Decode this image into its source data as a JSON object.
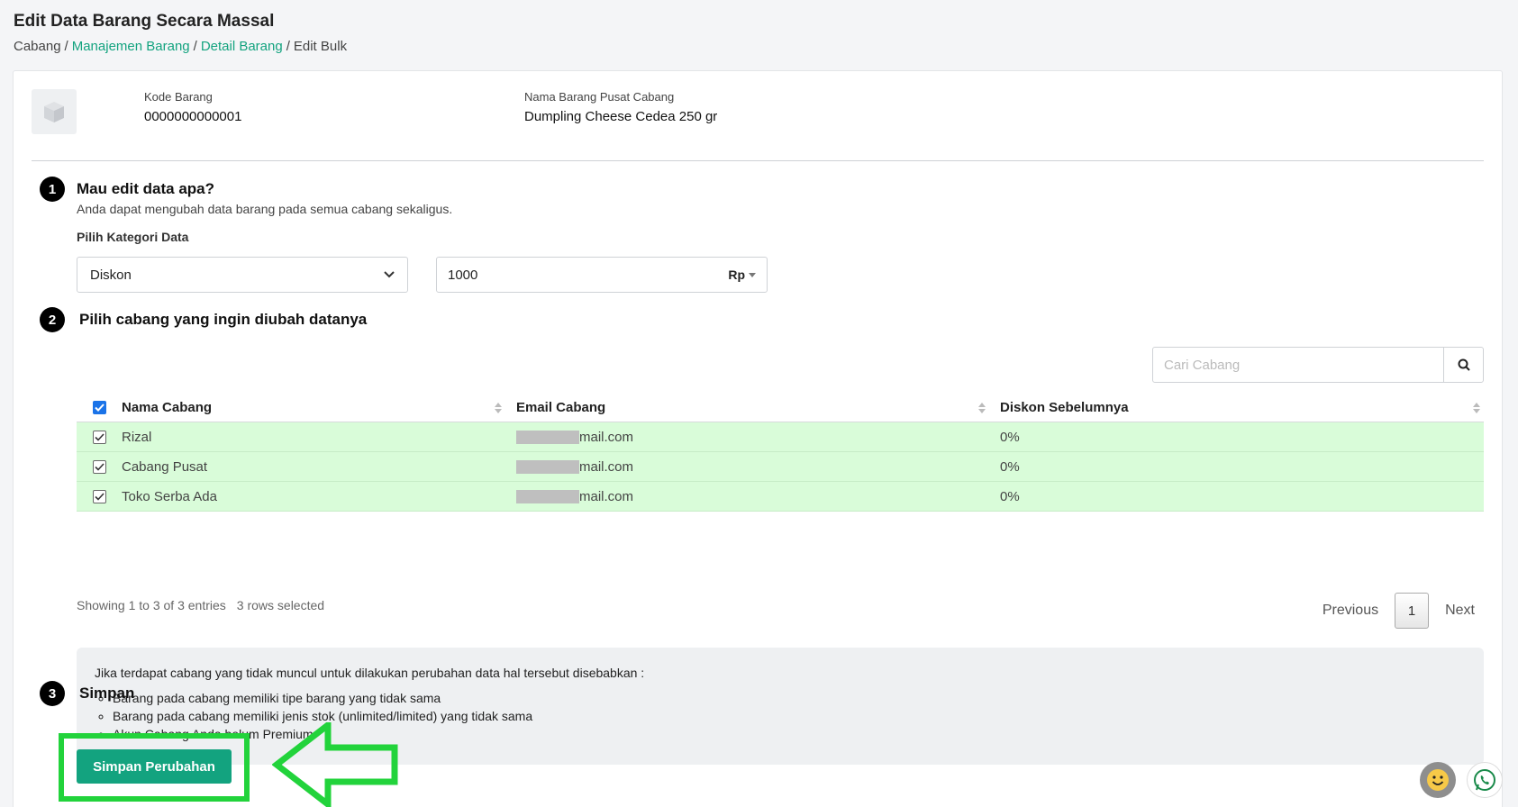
{
  "page": {
    "title": "Edit Data Barang Secara Massal",
    "breadcrumb": [
      "Cabang",
      "Manajemen Barang",
      "Detail Barang",
      "Edit Bulk"
    ]
  },
  "product": {
    "code_label": "Kode Barang",
    "code_value": "0000000000001",
    "name_label": "Nama Barang Pusat Cabang",
    "name_value": "Dumpling Cheese Cedea 250 gr"
  },
  "step1": {
    "number": "1",
    "title": "Mau edit data apa?",
    "subtitle": "Anda dapat mengubah data barang pada semua cabang sekaligus.",
    "category_label": "Pilih Kategori Data",
    "category_value": "Diskon",
    "amount_value": "1000",
    "amount_unit": "Rp"
  },
  "step2": {
    "number": "2",
    "title": "Pilih cabang yang ingin diubah datanya",
    "search_placeholder": "Cari Cabang",
    "table": {
      "columns": [
        "Nama Cabang",
        "Email Cabang",
        "Diskon Sebelumnya"
      ],
      "rows": [
        {
          "name": "Rizal",
          "email_suffix": "mail.com",
          "discount": "0%"
        },
        {
          "name": "Cabang Pusat",
          "email_suffix": "mail.com",
          "discount": "0%"
        },
        {
          "name": "Toko Serba Ada",
          "email_suffix": "mail.com",
          "discount": "0%"
        }
      ]
    },
    "entries_info": "Showing 1 to 3 of 3 entries",
    "selected_info": "3 rows selected",
    "pagination": {
      "previous": "Previous",
      "current": "1",
      "next": "Next"
    }
  },
  "note": {
    "intro": "Jika terdapat cabang yang tidak muncul untuk dilakukan perubahan data hal tersebut disebabkan :",
    "items": [
      "Barang pada cabang memiliki tipe barang yang tidak sama",
      "Barang pada cabang memiliki jenis stok (unlimited/limited) yang tidak sama",
      "Akun Cabang Anda belum Premium"
    ]
  },
  "step3": {
    "number": "3",
    "title": "Simpan",
    "save_label": "Simpan Perubahan"
  },
  "colors": {
    "accent": "#13a37f",
    "highlight": "#22d33b",
    "row_selected": "#d9fcd9",
    "checkbox": "#1a73e8"
  }
}
